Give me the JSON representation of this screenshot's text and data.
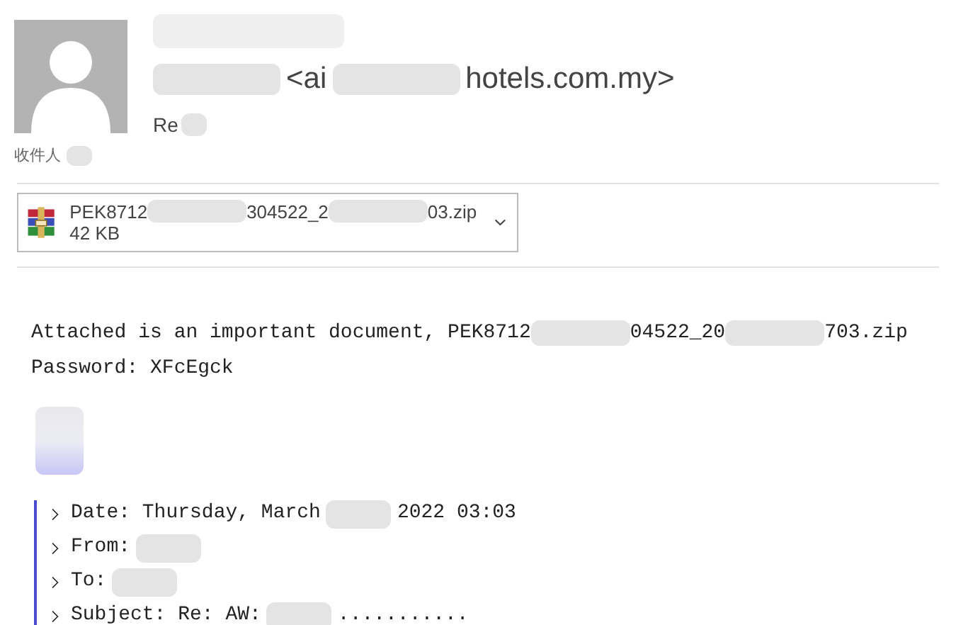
{
  "header": {
    "sender": [
      {
        "kind": "redacted"
      },
      {
        "kind": "text",
        "text": "<ai"
      },
      {
        "kind": "redacted"
      },
      {
        "kind": "text",
        "text": "hotels.com.my>"
      }
    ],
    "subject": [
      {
        "kind": "text",
        "text": "Re"
      },
      {
        "kind": "redacted"
      }
    ],
    "recipient": [
      {
        "kind": "text",
        "text": "收件人"
      },
      {
        "kind": "redacted"
      }
    ]
  },
  "attachment": {
    "name": [
      {
        "kind": "text",
        "text": "PEK8712"
      },
      {
        "kind": "redacted"
      },
      {
        "kind": "text",
        "text": "304522_2"
      },
      {
        "kind": "redacted"
      },
      {
        "kind": "text",
        "text": "03.zip"
      }
    ],
    "size": "42 KB"
  },
  "body": [
    [
      {
        "kind": "text",
        "text": "Attached is an important document, PEK8712"
      },
      {
        "kind": "redacted"
      },
      {
        "kind": "text",
        "text": "04522_20"
      },
      {
        "kind": "redacted"
      },
      {
        "kind": "text",
        "text": "703.zip"
      }
    ],
    [
      {
        "kind": "text",
        "text": "Password: XFcEgck"
      }
    ]
  ],
  "quote": [
    [
      {
        "kind": "text",
        "text": "Date: Thursday, March"
      },
      {
        "kind": "redacted"
      },
      {
        "kind": "text",
        "text": "2022 03:03"
      }
    ],
    [
      {
        "kind": "text",
        "text": "From:"
      },
      {
        "kind": "redacted"
      }
    ],
    [
      {
        "kind": "text",
        "text": "To:"
      },
      {
        "kind": "redacted"
      }
    ],
    [
      {
        "kind": "text",
        "text": "Subject: Re: AW:"
      },
      {
        "kind": "redacted"
      },
      {
        "kind": "text",
        "text": "..........."
      }
    ]
  ]
}
